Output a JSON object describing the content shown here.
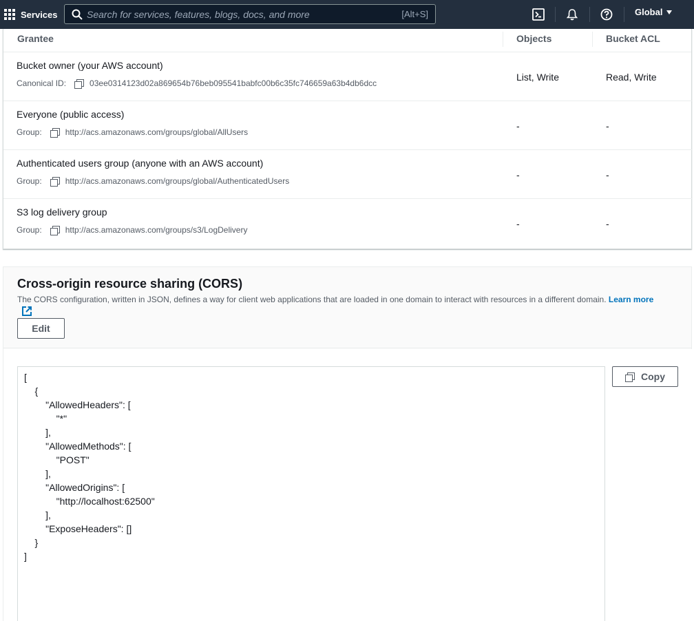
{
  "topnav": {
    "services_label": "Services",
    "search_placeholder": "Search for services, features, blogs, docs, and more",
    "search_shortcut": "[Alt+S]",
    "region_label": "Global",
    "icons": [
      "services-grid-icon",
      "search-icon",
      "cloudshell-icon",
      "bell-icon",
      "help-icon"
    ]
  },
  "acl_table": {
    "headers": {
      "grantee": "Grantee",
      "objects": "Objects",
      "bucket_acl": "Bucket ACL"
    },
    "rows": [
      {
        "name": "Bucket owner (your AWS account)",
        "sub_label": "Canonical ID:",
        "sub_value": "03ee0314123d02a869654b76beb095541babfc00b6c35fc746659a63b4db6dcc",
        "objects": "List, Write",
        "bucket_acl": "Read, Write"
      },
      {
        "name": "Everyone (public access)",
        "sub_label": "Group:",
        "sub_value": "http://acs.amazonaws.com/groups/global/AllUsers",
        "objects": "-",
        "bucket_acl": "-"
      },
      {
        "name": "Authenticated users group (anyone with an AWS account)",
        "sub_label": "Group:",
        "sub_value": "http://acs.amazonaws.com/groups/global/AuthenticatedUsers",
        "objects": "-",
        "bucket_acl": "-"
      },
      {
        "name": "S3 log delivery group",
        "sub_label": "Group:",
        "sub_value": "http://acs.amazonaws.com/groups/s3/LogDelivery",
        "objects": "-",
        "bucket_acl": "-"
      }
    ]
  },
  "cors": {
    "title": "Cross-origin resource sharing (CORS)",
    "description": "The CORS configuration, written in JSON, defines a way for client web applications that are loaded in one domain to interact with resources in a different domain.",
    "learn_more": "Learn more",
    "edit_label": "Edit",
    "copy_label": "Copy",
    "code_lines": [
      "[",
      "    {",
      "        \"AllowedHeaders\": [",
      "            \"*\"",
      "        ],",
      "        \"AllowedMethods\": [",
      "            \"POST\"",
      "        ],",
      "        \"AllowedOrigins\": [",
      "            \"http://localhost:62500\"",
      "        ],",
      "        \"ExposeHeaders\": []",
      "    }",
      "]"
    ]
  },
  "colors": {
    "nav_bg": "#232f3e",
    "link": "#0073bb",
    "text": "#16191f",
    "muted": "#545b64"
  }
}
